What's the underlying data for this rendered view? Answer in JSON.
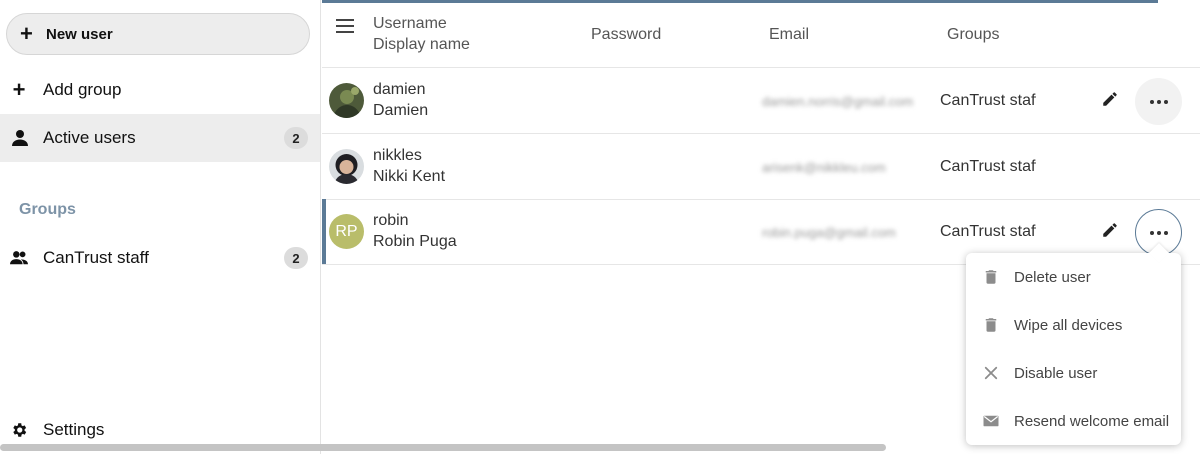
{
  "sidebar": {
    "new_user_label": "New user",
    "add_group_label": "Add group",
    "active_users": {
      "label": "Active users",
      "count": "2"
    },
    "groups_caption": "Groups",
    "groups": [
      {
        "label": "CanTrust staff",
        "count": "2"
      }
    ],
    "settings_label": "Settings"
  },
  "list": {
    "columns": {
      "username": "Username",
      "display_name": "Display name",
      "password": "Password",
      "email": "Email",
      "groups": "Groups"
    },
    "rows": [
      {
        "username": "damien",
        "display_name": "Damien",
        "email": "damien.norris@gmail.com",
        "groups": "CanTrust staff",
        "avatar": "photo"
      },
      {
        "username": "nikkles",
        "display_name": "Nikki Kent",
        "email": "arisenk@nikkleu.com",
        "groups": "CanTrust staff",
        "avatar": "photo"
      },
      {
        "username": "robin",
        "display_name": "Robin Puga",
        "email": "robin.puga@gmail.com",
        "groups": "CanTrust staff",
        "avatar_initials": "RP"
      }
    ]
  },
  "actions_menu": {
    "items": [
      {
        "label": "Delete user",
        "icon": "trash-icon"
      },
      {
        "label": "Wipe all devices",
        "icon": "trash-icon"
      },
      {
        "label": "Disable user",
        "icon": "close-icon"
      },
      {
        "label": "Resend welcome email",
        "icon": "mail-icon"
      }
    ]
  },
  "colors": {
    "accent": "#5b7a96",
    "initials_avatar": "#b9bd6a",
    "groups_caption": "#7d93a7"
  }
}
